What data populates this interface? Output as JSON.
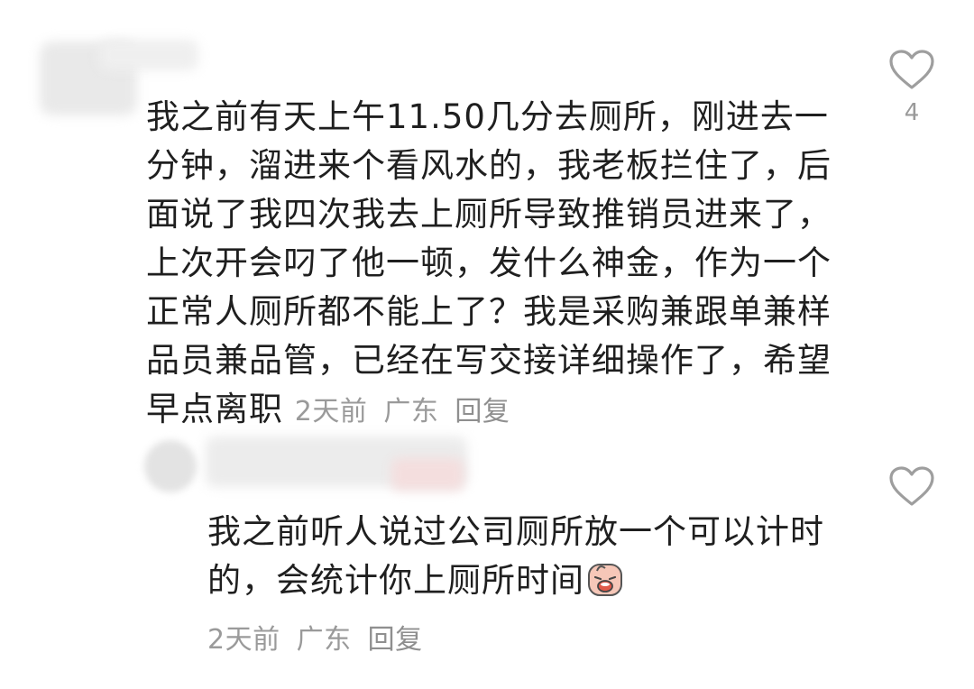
{
  "comment_1": {
    "username": "",
    "text": "我之前有天上午11.50几分去厕所，刚进去一分钟，溜进来个看风水的，我老板拦住了，后面说了我四次我去上厕所导致推销员进来了，上次开会叼了他一顿，发什么神金，作为一个正常人厕所都不能上了？我是采购兼跟单兼样品员兼品管，已经在写交接详细操作了，希望早点离职",
    "time": "2天前",
    "location": "广东",
    "reply_label": "回复",
    "like_count": "4"
  },
  "comment_2": {
    "username": "",
    "text": "我之前听人说过公司厕所放一个可以计时的，会统计你上厕所时间",
    "emoji": "crying-face-emoji",
    "time": "2天前",
    "location": "广东",
    "reply_label": "回复",
    "like_count": ""
  },
  "icons": {
    "like": "heart-outline-icon"
  },
  "colors": {
    "text": "#1f1f1f",
    "meta": "#9a9a9a",
    "icon": "#9e9e9e",
    "blur": "#e9e9e9"
  }
}
